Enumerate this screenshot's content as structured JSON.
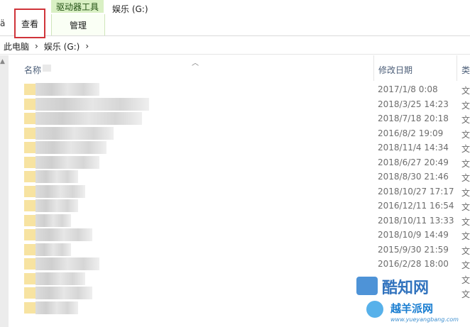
{
  "ribbon": {
    "tab_edge": "ä",
    "tab_view": "查看",
    "drive_tools_header": "驱动器工具",
    "drive_tools_manage": "管理",
    "window_title": "娱乐 (G:)"
  },
  "address": {
    "crumb_pc": "此电脑",
    "crumb_drive": "娱乐 (G:)",
    "separator": "›",
    "dropdown": "›"
  },
  "columns": {
    "name": "名称",
    "date_modified": "修改日期",
    "type": "类"
  },
  "files": [
    {
      "date": "2017/1/8 0:08",
      "type": "文"
    },
    {
      "date": "2018/3/25 14:23",
      "type": "文"
    },
    {
      "date": "2018/7/18 20:18",
      "type": "文"
    },
    {
      "date": "2016/8/2 19:09",
      "type": "文"
    },
    {
      "date": "2018/11/4 14:34",
      "type": "文"
    },
    {
      "date": "2018/6/27 20:49",
      "type": "文"
    },
    {
      "date": "2018/8/30 21:46",
      "type": "文"
    },
    {
      "date": "2018/10/27 17:17",
      "type": "文"
    },
    {
      "date": "2016/12/11 16:54",
      "type": "文"
    },
    {
      "date": "2018/10/11 13:33",
      "type": "文"
    },
    {
      "date": "2018/10/9 14:49",
      "type": "文"
    },
    {
      "date": "2015/9/30 21:59",
      "type": "文"
    },
    {
      "date": "2016/2/28 18:00",
      "type": "文"
    },
    {
      "date": "",
      "type": "文"
    },
    {
      "date": "",
      "type": "文"
    },
    {
      "date": "",
      "type": ""
    }
  ],
  "icons": {
    "sort": "sort-ascending-icon",
    "folder": "folder-icon",
    "chevron": "chevron-right-icon"
  },
  "watermarks": {
    "primary": "酷知网",
    "secondary": "越羊派网",
    "secondary_url": "www.yueyangbang.com"
  },
  "colors": {
    "view_tab_highlight": "#d0343a",
    "drive_tools_bg": "#d9f0c4",
    "folder": "#f7e3a1",
    "column_header_text": "#4c5e78",
    "meta_text": "#6d6d6d"
  }
}
